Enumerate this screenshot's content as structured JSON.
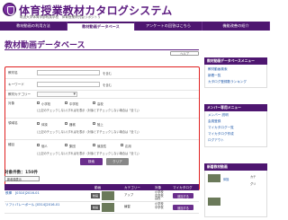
{
  "header": {
    "title": "体育授業教材カタログシステム",
    "subtitle": "筑波大学体育学部附属学校　体育授業研究会リポジトリ"
  },
  "nav": {
    "items": [
      "教材動画の利用方法",
      "教材動画データベース",
      "アンケートの回答はこちら",
      "機能改善の紹介"
    ]
  },
  "main": {
    "page_title": "教材動画データベース",
    "help_label": "ヘルプ",
    "form": {
      "title_label": "教材名",
      "title_hint": "を含む",
      "keyword_label": "キーワード",
      "keyword_hint": "を含む",
      "category_label": "教材カテゴリー",
      "target_label": "対象",
      "target_options": [
        "小学校",
        "中学校",
        "高校"
      ],
      "target_note": "(上記のチェックしない)すればを表示（対象とすチェックしない場合は「全て」）",
      "domain_label": "領域名",
      "domain_options": [
        "体操",
        "器械",
        "陸上"
      ],
      "domain_note": "(上記のチェックしない)すればを表示（対象とすチェックしない場合は「全て」）",
      "type_label": "種目",
      "type_options": [
        "個人",
        "集団",
        "競技性",
        "応用"
      ],
      "type_note": "(上記のチェックしない)すればを表示（対象とすチェックしない場合は「全て」）"
    },
    "search_button": "検索",
    "clear_button": "クリア",
    "result_count": "対象件数：150件",
    "sort_label": "新着順表示",
    "table": {
      "headers": [
        "動画",
        "カテゴリー",
        "対象",
        "マイカタログ"
      ],
      "rows": [
        {
          "title": "鉄棒　[0310]2016-01",
          "icon": "動画",
          "category": "アップ",
          "target": "小学校\n中学校\n高校",
          "badge": "追加する"
        },
        {
          "title": "ソフトバレーボール [0314]2016-01",
          "icon": "動画",
          "category": "練習",
          "target": "小学校\n中学校",
          "badge": "追加する"
        }
      ]
    }
  },
  "sidebar": {
    "section1_title": "教材動画データベースメニュー",
    "section1_links": [
      "教材動画検索",
      "新着一覧",
      "カタログ登録数ランキング"
    ],
    "section2_title": "メンバー専用メニュー",
    "section2_links": [
      "メンバー 説明",
      "会員登録",
      "マイカタログ一覧",
      "マイカタログ作成",
      "ログアウト"
    ],
    "section3_title": "新着教材動画",
    "ranking_items": [
      "体操",
      "カテ",
      "グリ"
    ]
  },
  "colors": {
    "brand_purple": "#4e1670",
    "title_purple": "#5b1a7f",
    "form_border": "#e02020",
    "link_blue": "#1a55a8"
  }
}
